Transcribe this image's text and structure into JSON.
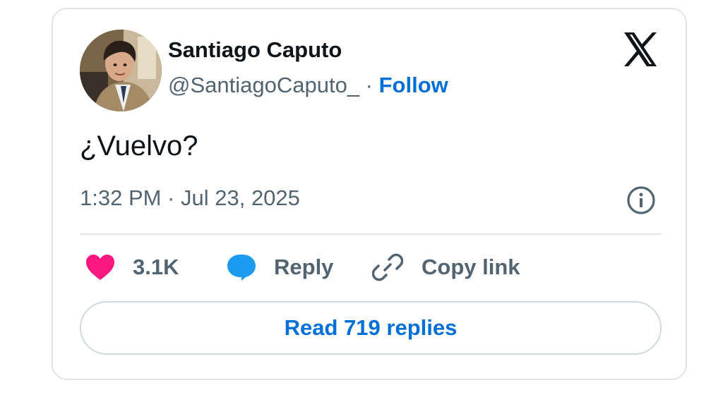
{
  "author": {
    "name": "Santiago Caputo",
    "handle": "@SantiagoCaputo_",
    "separator": " · ",
    "follow_label": "Follow"
  },
  "tweet": {
    "text": "¿Vuelvo?",
    "timestamp": "1:32 PM · Jul 23, 2025"
  },
  "actions": {
    "likes_count": "3.1K",
    "reply_label": "Reply",
    "copy_link_label": "Copy link"
  },
  "read_replies_label": "Read 719 replies",
  "icons": {
    "like": "heart-icon",
    "reply": "speech-bubble-icon",
    "copy": "link-icon",
    "info": "info-icon",
    "brand": "x-logo-icon"
  },
  "colors": {
    "like": "#f91880",
    "reply": "#1d9bf0",
    "link_blue": "#006fd6",
    "secondary_text": "#536471",
    "primary_text": "#0f1419"
  }
}
